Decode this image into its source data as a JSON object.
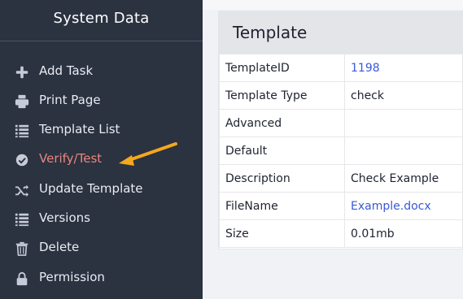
{
  "sidebar": {
    "title": "System Data",
    "items": [
      {
        "label": "Add Task",
        "icon": "plus-icon"
      },
      {
        "label": "Print Page",
        "icon": "print-icon"
      },
      {
        "label": "Template List",
        "icon": "list-icon"
      },
      {
        "label": "Verify/Test",
        "icon": "check-circle-icon",
        "active": true
      },
      {
        "label": "Update Template",
        "icon": "shuffle-icon"
      },
      {
        "label": "Versions",
        "icon": "list-icon"
      },
      {
        "label": "Delete",
        "icon": "trash-icon"
      },
      {
        "label": "Permission",
        "icon": "lock-icon"
      }
    ]
  },
  "annotation": {
    "icon": "arrow-icon",
    "color": "#f4a81d"
  },
  "panel": {
    "title": "Template",
    "rows": [
      {
        "key": "TemplateID",
        "value": "1198",
        "link": true
      },
      {
        "key": "Template Type",
        "value": "check"
      },
      {
        "key": "Advanced",
        "value": ""
      },
      {
        "key": "Default",
        "value": ""
      },
      {
        "key": "Description",
        "value": "Check Example"
      },
      {
        "key": "FileName",
        "value": "Example.docx",
        "link": true
      },
      {
        "key": "Size",
        "value": "0.01mb"
      }
    ]
  },
  "colors": {
    "sidebar_bg": "#2b3240",
    "active_label": "#e8877d",
    "link": "#3a59d6",
    "page_bg": "#f1f2f6"
  }
}
